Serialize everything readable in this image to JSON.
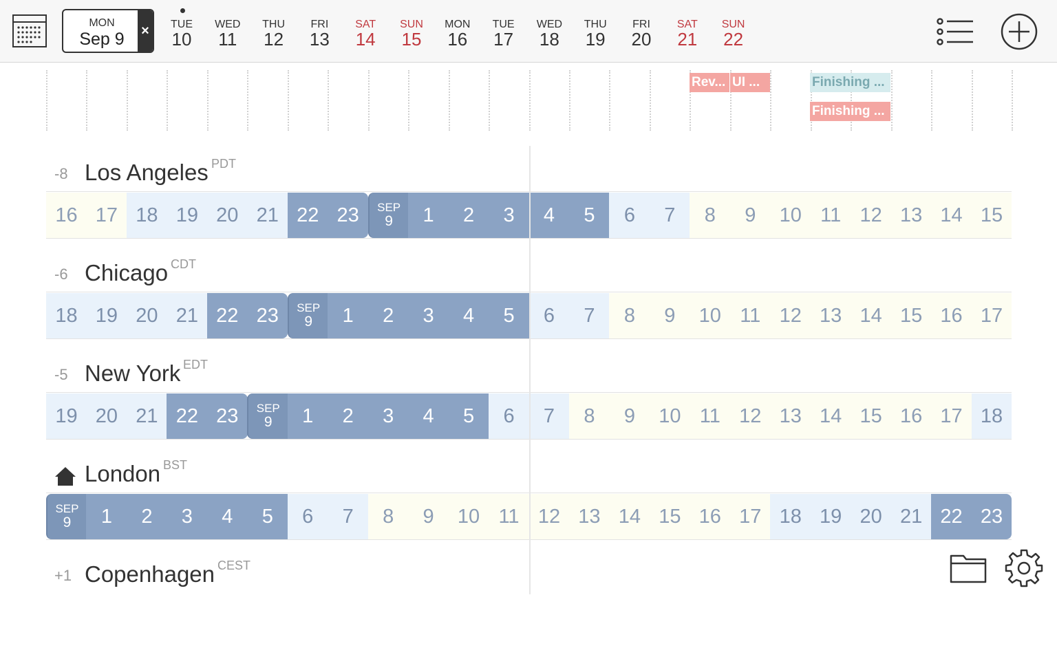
{
  "header": {
    "selected": {
      "dow": "MON",
      "date": "Sep 9",
      "close": "×"
    },
    "days": [
      {
        "dow": "TUE",
        "num": "10",
        "weekend": false,
        "has_event": true
      },
      {
        "dow": "WED",
        "num": "11",
        "weekend": false,
        "has_event": false
      },
      {
        "dow": "THU",
        "num": "12",
        "weekend": false,
        "has_event": false
      },
      {
        "dow": "FRI",
        "num": "13",
        "weekend": false,
        "has_event": false
      },
      {
        "dow": "SAT",
        "num": "14",
        "weekend": true,
        "has_event": false
      },
      {
        "dow": "SUN",
        "num": "15",
        "weekend": true,
        "has_event": false
      },
      {
        "dow": "MON",
        "num": "16",
        "weekend": false,
        "has_event": false
      },
      {
        "dow": "TUE",
        "num": "17",
        "weekend": false,
        "has_event": false
      },
      {
        "dow": "WED",
        "num": "18",
        "weekend": false,
        "has_event": false
      },
      {
        "dow": "THU",
        "num": "19",
        "weekend": false,
        "has_event": false
      },
      {
        "dow": "FRI",
        "num": "20",
        "weekend": false,
        "has_event": false
      },
      {
        "dow": "SAT",
        "num": "21",
        "weekend": true,
        "has_event": false
      },
      {
        "dow": "SUN",
        "num": "22",
        "weekend": true,
        "has_event": false
      }
    ],
    "icons": {
      "calendar": "calendar-icon",
      "list": "list-icon",
      "add": "add-circle-icon"
    }
  },
  "events": [
    {
      "label": "Rev...",
      "color": "#f4a6a2"
    },
    {
      "label": "UI ...",
      "color": "#f4a6a2"
    },
    {
      "label": "Finishing ...",
      "color": "#d6ecee",
      "text_color": "#7aa9b0"
    },
    {
      "label": "Finishing ...",
      "color": "#f4a6a2"
    }
  ],
  "zones": [
    {
      "offset": "-8",
      "city": "Los Angeles",
      "abbr": "PDT",
      "home": false,
      "hours": [
        "16",
        "17",
        "18",
        "19",
        "20",
        "21",
        "22",
        "23",
        "SEP 9",
        "1",
        "2",
        "3",
        "4",
        "5",
        "6",
        "7",
        "8",
        "9",
        "10",
        "11",
        "12",
        "13",
        "14",
        "15"
      ]
    },
    {
      "offset": "-6",
      "city": "Chicago",
      "abbr": "CDT",
      "home": false,
      "hours": [
        "18",
        "19",
        "20",
        "21",
        "22",
        "23",
        "SEP 9",
        "1",
        "2",
        "3",
        "4",
        "5",
        "6",
        "7",
        "8",
        "9",
        "10",
        "11",
        "12",
        "13",
        "14",
        "15",
        "16",
        "17"
      ]
    },
    {
      "offset": "-5",
      "city": "New York",
      "abbr": "EDT",
      "home": false,
      "hours": [
        "19",
        "20",
        "21",
        "22",
        "23",
        "SEP 9",
        "1",
        "2",
        "3",
        "4",
        "5",
        "6",
        "7",
        "8",
        "9",
        "10",
        "11",
        "12",
        "13",
        "14",
        "15",
        "16",
        "17",
        "18"
      ]
    },
    {
      "offset": "",
      "city": "London",
      "abbr": "BST",
      "home": true,
      "hours": [
        "SEP 9",
        "1",
        "2",
        "3",
        "4",
        "5",
        "6",
        "7",
        "8",
        "9",
        "10",
        "11",
        "12",
        "13",
        "14",
        "15",
        "16",
        "17",
        "18",
        "19",
        "20",
        "21",
        "22",
        "23"
      ]
    },
    {
      "offset": "+1",
      "city": "Copenhagen",
      "abbr": "CEST",
      "home": false,
      "hours": []
    }
  ],
  "colors": {
    "sleep": "#8ba3c4",
    "edge": "#e9f2fb",
    "work": "#fdfdf1",
    "weekend_text": "#c0393f"
  },
  "footer": {
    "folder_icon": "folder-icon",
    "settings_icon": "gear-icon"
  }
}
